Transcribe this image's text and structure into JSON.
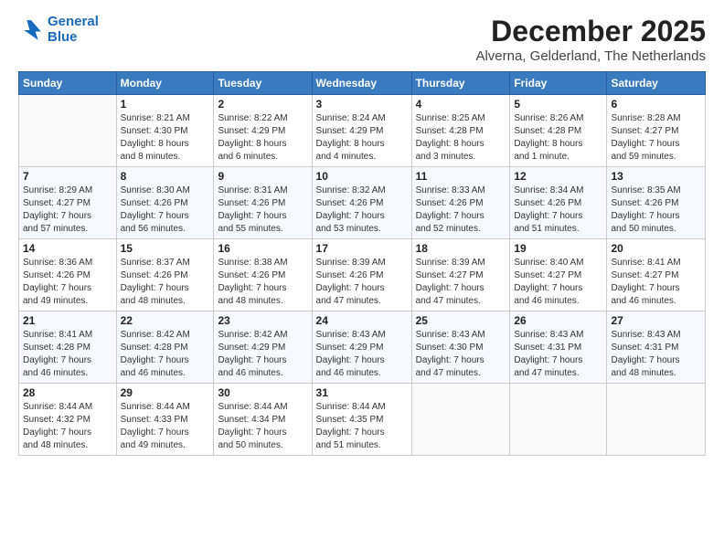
{
  "logo": {
    "line1": "General",
    "line2": "Blue"
  },
  "title": "December 2025",
  "subtitle": "Alverna, Gelderland, The Netherlands",
  "days_of_week": [
    "Sunday",
    "Monday",
    "Tuesday",
    "Wednesday",
    "Thursday",
    "Friday",
    "Saturday"
  ],
  "weeks": [
    [
      {
        "day": "",
        "info": ""
      },
      {
        "day": "1",
        "info": "Sunrise: 8:21 AM\nSunset: 4:30 PM\nDaylight: 8 hours\nand 8 minutes."
      },
      {
        "day": "2",
        "info": "Sunrise: 8:22 AM\nSunset: 4:29 PM\nDaylight: 8 hours\nand 6 minutes."
      },
      {
        "day": "3",
        "info": "Sunrise: 8:24 AM\nSunset: 4:29 PM\nDaylight: 8 hours\nand 4 minutes."
      },
      {
        "day": "4",
        "info": "Sunrise: 8:25 AM\nSunset: 4:28 PM\nDaylight: 8 hours\nand 3 minutes."
      },
      {
        "day": "5",
        "info": "Sunrise: 8:26 AM\nSunset: 4:28 PM\nDaylight: 8 hours\nand 1 minute."
      },
      {
        "day": "6",
        "info": "Sunrise: 8:28 AM\nSunset: 4:27 PM\nDaylight: 7 hours\nand 59 minutes."
      }
    ],
    [
      {
        "day": "7",
        "info": "Sunrise: 8:29 AM\nSunset: 4:27 PM\nDaylight: 7 hours\nand 57 minutes."
      },
      {
        "day": "8",
        "info": "Sunrise: 8:30 AM\nSunset: 4:26 PM\nDaylight: 7 hours\nand 56 minutes."
      },
      {
        "day": "9",
        "info": "Sunrise: 8:31 AM\nSunset: 4:26 PM\nDaylight: 7 hours\nand 55 minutes."
      },
      {
        "day": "10",
        "info": "Sunrise: 8:32 AM\nSunset: 4:26 PM\nDaylight: 7 hours\nand 53 minutes."
      },
      {
        "day": "11",
        "info": "Sunrise: 8:33 AM\nSunset: 4:26 PM\nDaylight: 7 hours\nand 52 minutes."
      },
      {
        "day": "12",
        "info": "Sunrise: 8:34 AM\nSunset: 4:26 PM\nDaylight: 7 hours\nand 51 minutes."
      },
      {
        "day": "13",
        "info": "Sunrise: 8:35 AM\nSunset: 4:26 PM\nDaylight: 7 hours\nand 50 minutes."
      }
    ],
    [
      {
        "day": "14",
        "info": "Sunrise: 8:36 AM\nSunset: 4:26 PM\nDaylight: 7 hours\nand 49 minutes."
      },
      {
        "day": "15",
        "info": "Sunrise: 8:37 AM\nSunset: 4:26 PM\nDaylight: 7 hours\nand 48 minutes."
      },
      {
        "day": "16",
        "info": "Sunrise: 8:38 AM\nSunset: 4:26 PM\nDaylight: 7 hours\nand 48 minutes."
      },
      {
        "day": "17",
        "info": "Sunrise: 8:39 AM\nSunset: 4:26 PM\nDaylight: 7 hours\nand 47 minutes."
      },
      {
        "day": "18",
        "info": "Sunrise: 8:39 AM\nSunset: 4:27 PM\nDaylight: 7 hours\nand 47 minutes."
      },
      {
        "day": "19",
        "info": "Sunrise: 8:40 AM\nSunset: 4:27 PM\nDaylight: 7 hours\nand 46 minutes."
      },
      {
        "day": "20",
        "info": "Sunrise: 8:41 AM\nSunset: 4:27 PM\nDaylight: 7 hours\nand 46 minutes."
      }
    ],
    [
      {
        "day": "21",
        "info": "Sunrise: 8:41 AM\nSunset: 4:28 PM\nDaylight: 7 hours\nand 46 minutes."
      },
      {
        "day": "22",
        "info": "Sunrise: 8:42 AM\nSunset: 4:28 PM\nDaylight: 7 hours\nand 46 minutes."
      },
      {
        "day": "23",
        "info": "Sunrise: 8:42 AM\nSunset: 4:29 PM\nDaylight: 7 hours\nand 46 minutes."
      },
      {
        "day": "24",
        "info": "Sunrise: 8:43 AM\nSunset: 4:29 PM\nDaylight: 7 hours\nand 46 minutes."
      },
      {
        "day": "25",
        "info": "Sunrise: 8:43 AM\nSunset: 4:30 PM\nDaylight: 7 hours\nand 47 minutes."
      },
      {
        "day": "26",
        "info": "Sunrise: 8:43 AM\nSunset: 4:31 PM\nDaylight: 7 hours\nand 47 minutes."
      },
      {
        "day": "27",
        "info": "Sunrise: 8:43 AM\nSunset: 4:31 PM\nDaylight: 7 hours\nand 48 minutes."
      }
    ],
    [
      {
        "day": "28",
        "info": "Sunrise: 8:44 AM\nSunset: 4:32 PM\nDaylight: 7 hours\nand 48 minutes."
      },
      {
        "day": "29",
        "info": "Sunrise: 8:44 AM\nSunset: 4:33 PM\nDaylight: 7 hours\nand 49 minutes."
      },
      {
        "day": "30",
        "info": "Sunrise: 8:44 AM\nSunset: 4:34 PM\nDaylight: 7 hours\nand 50 minutes."
      },
      {
        "day": "31",
        "info": "Sunrise: 8:44 AM\nSunset: 4:35 PM\nDaylight: 7 hours\nand 51 minutes."
      },
      {
        "day": "",
        "info": ""
      },
      {
        "day": "",
        "info": ""
      },
      {
        "day": "",
        "info": ""
      }
    ]
  ]
}
